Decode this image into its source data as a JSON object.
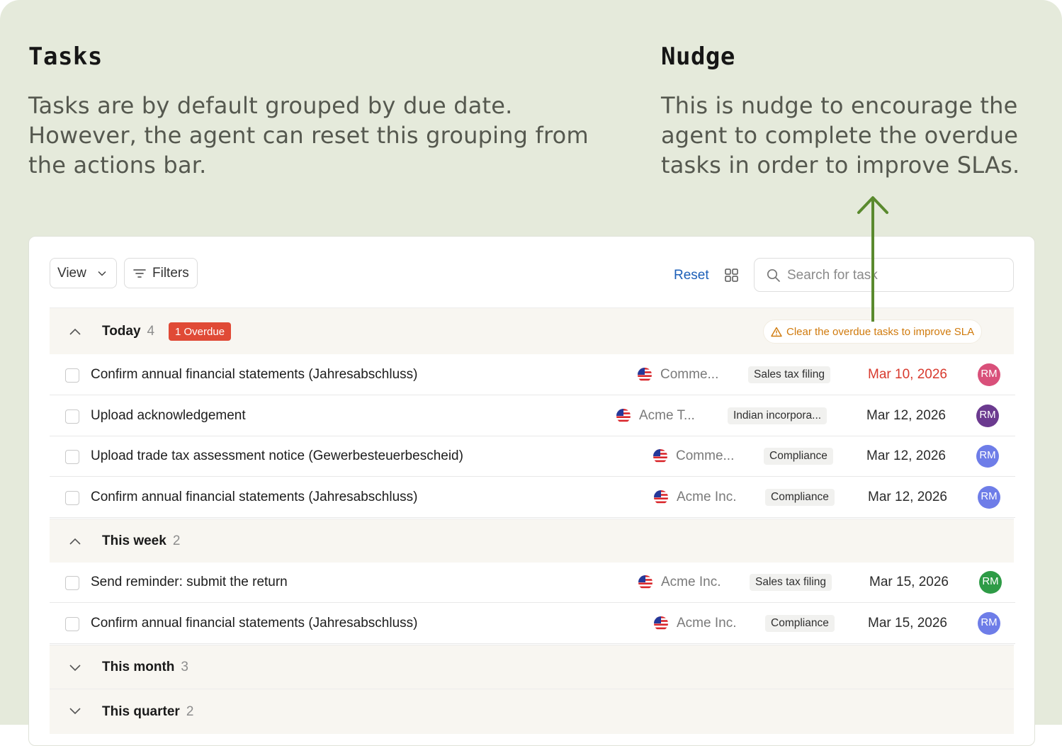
{
  "annotations": {
    "tasks": {
      "title": "Tasks",
      "text": "Tasks are by default grouped by due date. However, the agent can reset this grouping from the actions bar."
    },
    "nudge": {
      "title": "Nudge",
      "text": "This is nudge to encourage the agent to complete the overdue tasks in order to improve SLAs."
    }
  },
  "toolbar": {
    "view_label": "View",
    "filters_label": "Filters",
    "reset_label": "Reset",
    "search_placeholder": "Search for task"
  },
  "groups": [
    {
      "name": "Today",
      "count": "4",
      "expanded": true,
      "badge": "1 Overdue",
      "nudge": "Clear the overdue tasks to improve SLA",
      "tasks": [
        {
          "title": "Confirm annual financial statements (Jahresabschluss)",
          "client": "Comme...",
          "tag": "Sales tax filing",
          "due": "Mar 10, 2026",
          "overdue": true,
          "assignee": "RM",
          "avatar_color": "#d9507a"
        },
        {
          "title": "Upload acknowledgement",
          "client": "Acme T...",
          "tag": "Indian incorpora...",
          "due": "Mar 12, 2026",
          "overdue": false,
          "assignee": "RM",
          "avatar_color": "#6b3a8f"
        },
        {
          "title": "Upload trade tax assessment notice (Gewerbesteuerbescheid)",
          "client": "Comme...",
          "tag": "Compliance",
          "due": "Mar 12, 2026",
          "overdue": false,
          "assignee": "RM",
          "avatar_color": "#6e7de8"
        },
        {
          "title": "Confirm annual financial statements (Jahresabschluss)",
          "client": "Acme Inc.",
          "tag": "Compliance",
          "due": "Mar 12, 2026",
          "overdue": false,
          "assignee": "RM",
          "avatar_color": "#6e7de8"
        }
      ]
    },
    {
      "name": "This week",
      "count": "2",
      "expanded": true,
      "tasks": [
        {
          "title": "Send reminder: submit the return",
          "client": "Acme Inc.",
          "tag": "Sales tax filing",
          "due": "Mar 15, 2026",
          "overdue": false,
          "assignee": "RM",
          "avatar_color": "#2e9b46"
        },
        {
          "title": "Confirm annual financial statements (Jahresabschluss)",
          "client": "Acme Inc.",
          "tag": "Compliance",
          "due": "Mar 15, 2026",
          "overdue": false,
          "assignee": "RM",
          "avatar_color": "#6e7de8"
        }
      ]
    },
    {
      "name": "This month",
      "count": "3",
      "expanded": false
    },
    {
      "name": "This quarter",
      "count": "2",
      "expanded": false
    }
  ],
  "colors": {
    "background": "#e5eadb",
    "accent_link": "#1c5fb8",
    "overdue_red": "#d83a2e",
    "nudge_orange": "#d07a0c",
    "arrow_green": "#5a8a2e"
  }
}
